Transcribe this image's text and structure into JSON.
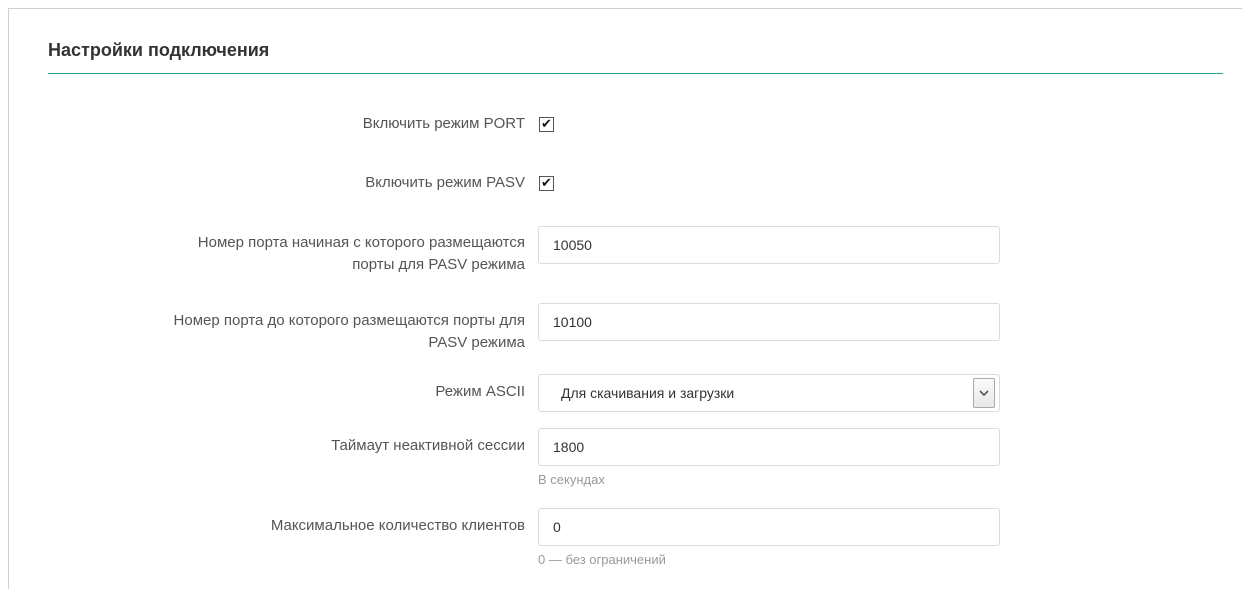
{
  "section": {
    "title": "Настройки подключения"
  },
  "fields": {
    "port_mode": {
      "label": "Включить режим PORT",
      "checked": true,
      "check_glyph": "✔"
    },
    "pasv_mode": {
      "label": "Включить режим PASV",
      "checked": true,
      "check_glyph": "✔"
    },
    "pasv_port_start": {
      "label_line1": "Номер порта начиная с которого размещаются",
      "label_line2": "порты для PASV режима",
      "value": "10050"
    },
    "pasv_port_end": {
      "label_line1": "Номер порта до которого размещаются порты для",
      "label_line2": "PASV режима",
      "value": "10100"
    },
    "ascii_mode": {
      "label": "Режим ASCII",
      "selected": "Для скачивания и загрузки",
      "arrow_icon": "chevron-down-icon"
    },
    "session_timeout": {
      "label": "Таймаут неактивной сессии",
      "value": "1800",
      "hint": "В секундах"
    },
    "max_clients": {
      "label": "Максимальное количество клиентов",
      "value": "0",
      "hint": "0 — без ограничений"
    }
  },
  "colors": {
    "accent_rule": "#2aa58b"
  }
}
